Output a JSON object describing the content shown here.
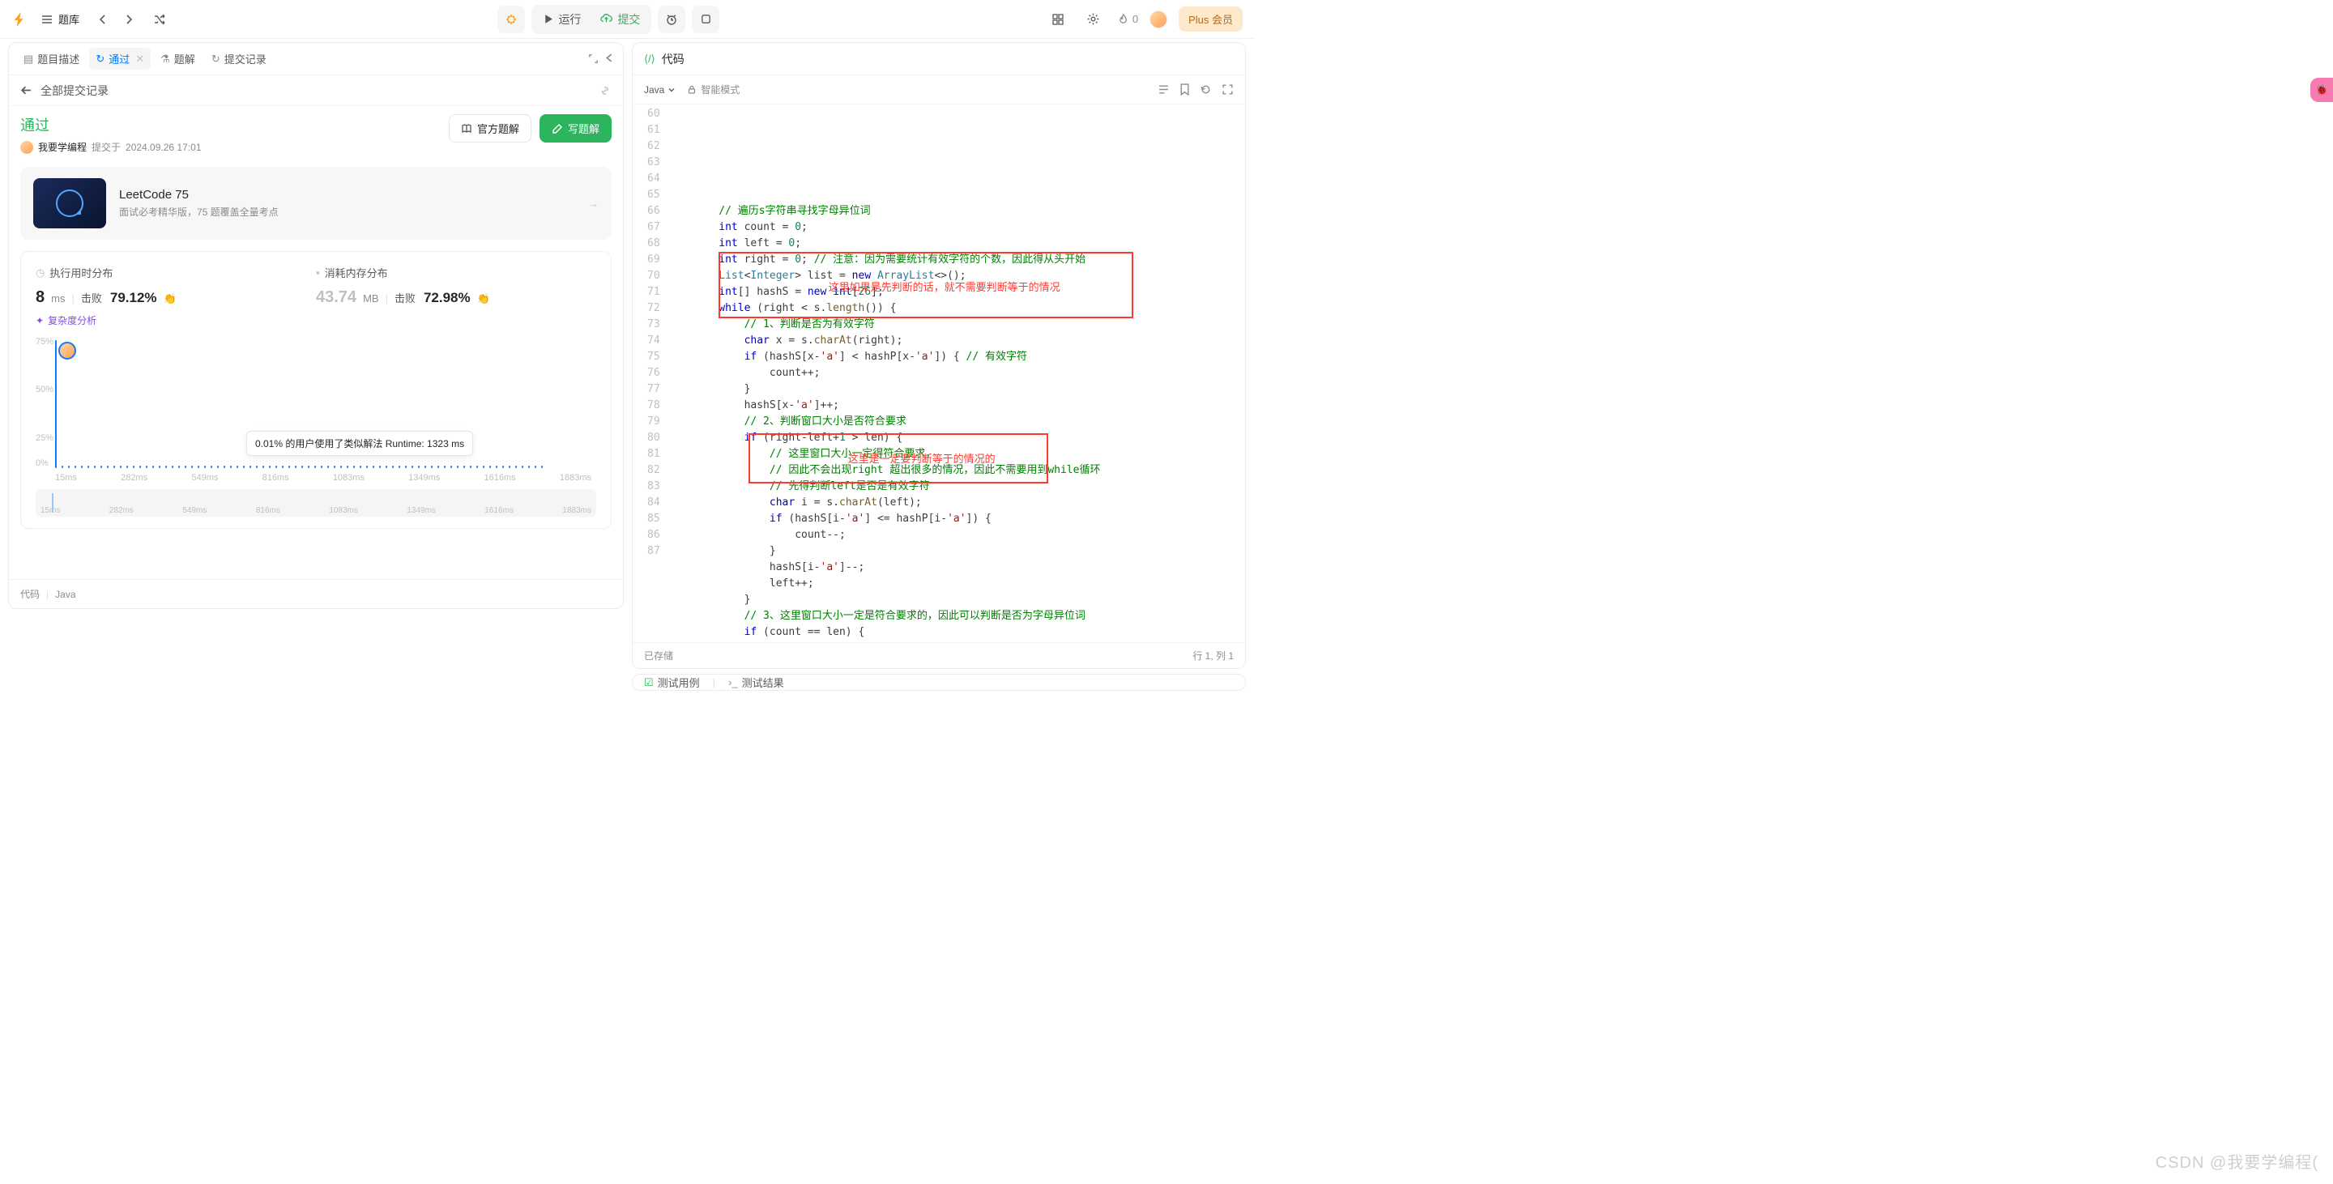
{
  "topbar": {
    "bank": "题库",
    "run": "运行",
    "submit": "提交",
    "streak": "0",
    "plus": "Plus 会员"
  },
  "left": {
    "tabs": {
      "desc": "题目描述",
      "accepted": "通过",
      "editorial": "题解",
      "submissions": "提交记录"
    },
    "breadcrumb": "全部提交记录",
    "status": "通过",
    "user": "我要学编程",
    "submitted_prefix": "提交于",
    "submitted_time": "2024.09.26 17:01",
    "official": "官方题解",
    "write": "写题解",
    "promo": {
      "title": "LeetCode 75",
      "sub": "面试必考精华版，75 题覆盖全量考点"
    },
    "runtime": {
      "label": "执行用时分布",
      "value": "8",
      "unit": "ms",
      "beats_label": "击败",
      "beats": "79.12%"
    },
    "memory": {
      "label": "消耗内存分布",
      "value": "43.74",
      "unit": "MB",
      "beats_label": "击败",
      "beats": "72.98%"
    },
    "complexity": "复杂度分析",
    "tooltip": "0.01% 的用户使用了类似解法 Runtime: 1323 ms",
    "yticks": [
      "75%",
      "50%",
      "25%",
      "0%"
    ],
    "xticks": [
      "15ms",
      "282ms",
      "549ms",
      "816ms",
      "1083ms",
      "1349ms",
      "1616ms",
      "1883ms"
    ],
    "footer": {
      "code": "代码",
      "lang": "Java"
    }
  },
  "right": {
    "title": "代码",
    "lang": "Java",
    "smart": "智能模式",
    "saved": "已存储",
    "pos": "行 1, 列 1",
    "bt_tc": "测试用例",
    "bt_tr": "测试结果",
    "annot1": "这里如果是先判断的话，就不需要判断等于的情况",
    "annot2": "这里是一定要判断等于的情况的",
    "lines": [
      {
        "n": 60,
        "i": 2,
        "t": [
          [
            "cm",
            "// 遍历s字符串寻找字母异位词"
          ]
        ]
      },
      {
        "n": 61,
        "i": 2,
        "t": [
          [
            "kw",
            "int"
          ],
          [
            "",
            " count = "
          ],
          [
            "num",
            "0"
          ],
          [
            "",
            ";"
          ]
        ]
      },
      {
        "n": 62,
        "i": 2,
        "t": [
          [
            "kw",
            "int"
          ],
          [
            "",
            " left = "
          ],
          [
            "num",
            "0"
          ],
          [
            "",
            ";"
          ]
        ]
      },
      {
        "n": 63,
        "i": 2,
        "t": [
          [
            "kw",
            "int"
          ],
          [
            "",
            " right = "
          ],
          [
            "num",
            "0"
          ],
          [
            "",
            "; "
          ],
          [
            "cm",
            "// 注意：因为需要统计有效字符的个数，因此得从头开始"
          ]
        ]
      },
      {
        "n": 64,
        "i": 2,
        "t": [
          [
            "ty",
            "List"
          ],
          [
            "",
            "<"
          ],
          [
            "ty",
            "Integer"
          ],
          [
            "",
            "> list = "
          ],
          [
            "kw",
            "new"
          ],
          [
            "",
            " "
          ],
          [
            "ty",
            "ArrayList"
          ],
          [
            "",
            "<>();"
          ]
        ]
      },
      {
        "n": 65,
        "i": 2,
        "t": [
          [
            "kw",
            "int"
          ],
          [
            "",
            "[] hashS = "
          ],
          [
            "kw",
            "new"
          ],
          [
            "",
            " "
          ],
          [
            "kw",
            "int"
          ],
          [
            "",
            "["
          ],
          [
            "num",
            "26"
          ],
          [
            "",
            "];"
          ]
        ]
      },
      {
        "n": 66,
        "i": 2,
        "t": [
          [
            "kw",
            "while"
          ],
          [
            "",
            " (right < s."
          ],
          [
            "fn",
            "length"
          ],
          [
            "",
            "()) {"
          ]
        ]
      },
      {
        "n": 67,
        "i": 3,
        "t": [
          [
            "cm",
            "// 1、判断是否为有效字符"
          ]
        ]
      },
      {
        "n": 68,
        "i": 3,
        "t": [
          [
            "kw",
            "char"
          ],
          [
            "",
            " x = s."
          ],
          [
            "fn",
            "charAt"
          ],
          [
            "",
            "(right);"
          ]
        ]
      },
      {
        "n": 69,
        "i": 0,
        "t": [
          [
            "",
            ""
          ]
        ]
      },
      {
        "n": 70,
        "i": 3,
        "t": [
          [
            "kw",
            "if"
          ],
          [
            "",
            " (hashS[x-"
          ],
          [
            "str",
            "'a'"
          ],
          [
            "",
            "] < hashP[x-"
          ],
          [
            "str",
            "'a'"
          ],
          [
            "",
            "]) { "
          ],
          [
            "cm",
            "// 有效字符"
          ]
        ]
      },
      {
        "n": 71,
        "i": 4,
        "t": [
          [
            "",
            "count++;"
          ]
        ]
      },
      {
        "n": 72,
        "i": 3,
        "t": [
          [
            "",
            "}"
          ]
        ]
      },
      {
        "n": 73,
        "i": 3,
        "t": [
          [
            "",
            "hashS[x-"
          ],
          [
            "str",
            "'a'"
          ],
          [
            "",
            "]++;"
          ]
        ]
      },
      {
        "n": 74,
        "i": 3,
        "t": [
          [
            "cm",
            "// 2、判断窗口大小是否符合要求"
          ]
        ]
      },
      {
        "n": 75,
        "i": 3,
        "t": [
          [
            "kw",
            "if"
          ],
          [
            "",
            " (right-left+"
          ],
          [
            "num",
            "1"
          ],
          [
            "",
            " > len) {"
          ]
        ]
      },
      {
        "n": 76,
        "i": 4,
        "t": [
          [
            "cm",
            "// 这里窗口大小一定得符合要求，"
          ]
        ]
      },
      {
        "n": 77,
        "i": 4,
        "t": [
          [
            "cm",
            "// 因此不会出现right 超出很多的情况，因此不需要用到while循环"
          ]
        ]
      },
      {
        "n": 78,
        "i": 4,
        "t": [
          [
            "cm",
            "// 先得判断left是否是有效字符"
          ]
        ]
      },
      {
        "n": 79,
        "i": 4,
        "t": [
          [
            "kw",
            "char"
          ],
          [
            "",
            " i = s."
          ],
          [
            "fn",
            "charAt"
          ],
          [
            "",
            "(left);"
          ]
        ]
      },
      {
        "n": 80,
        "i": 4,
        "t": [
          [
            "kw",
            "if"
          ],
          [
            "",
            " (hashS[i-"
          ],
          [
            "str",
            "'a'"
          ],
          [
            "",
            "] <= hashP[i-"
          ],
          [
            "str",
            "'a'"
          ],
          [
            "",
            "]) {"
          ]
        ]
      },
      {
        "n": 81,
        "i": 5,
        "t": [
          [
            "",
            "count--;"
          ]
        ]
      },
      {
        "n": 82,
        "i": 4,
        "t": [
          [
            "",
            "}"
          ]
        ]
      },
      {
        "n": 83,
        "i": 4,
        "t": [
          [
            "",
            "hashS[i-"
          ],
          [
            "str",
            "'a'"
          ],
          [
            "",
            "]--;"
          ]
        ]
      },
      {
        "n": 84,
        "i": 4,
        "t": [
          [
            "",
            "left++;"
          ]
        ]
      },
      {
        "n": 85,
        "i": 3,
        "t": [
          [
            "",
            "}"
          ]
        ]
      },
      {
        "n": 86,
        "i": 3,
        "t": [
          [
            "cm",
            "// 3、这里窗口大小一定是符合要求的，因此可以判断是否为字母异位词"
          ]
        ]
      },
      {
        "n": 87,
        "i": 3,
        "t": [
          [
            "kw",
            "if"
          ],
          [
            "",
            " (count == len) {"
          ]
        ]
      }
    ]
  },
  "chart_data": {
    "type": "bar",
    "title": "执行用时分布",
    "xlabel": "ms",
    "ylabel": "%",
    "ylim": [
      0,
      75
    ],
    "xticks": [
      "15ms",
      "282ms",
      "549ms",
      "816ms",
      "1083ms",
      "1349ms",
      "1616ms",
      "1883ms"
    ],
    "categories": [
      15,
      40,
      65,
      90,
      115,
      140,
      165,
      190,
      215,
      240,
      265,
      290,
      315,
      340,
      365,
      390,
      415,
      440,
      465,
      490,
      515,
      540,
      565,
      590,
      615,
      640,
      665,
      690,
      715,
      740,
      765,
      790,
      815,
      840,
      865,
      890,
      915,
      940,
      965,
      990,
      1015,
      1040,
      1065,
      1090,
      1115,
      1140,
      1165,
      1190,
      1215,
      1240,
      1265,
      1290,
      1315,
      1340,
      1365,
      1390,
      1415,
      1440,
      1465,
      1490,
      1515,
      1540,
      1565,
      1590,
      1615,
      1640,
      1665,
      1690,
      1715,
      1740,
      1765,
      1790,
      1815,
      1840,
      1865,
      1890
    ],
    "values": [
      75,
      1,
      1,
      1,
      1,
      1,
      1,
      1,
      1,
      1,
      1,
      1,
      1,
      1,
      1,
      1,
      1,
      1,
      1,
      1,
      1,
      1,
      1,
      1,
      1,
      1,
      1,
      1,
      1,
      1,
      1,
      1,
      1,
      1,
      1,
      1,
      1,
      1,
      1,
      1,
      1,
      1,
      1,
      1,
      1,
      1,
      1,
      1,
      1,
      1,
      1,
      1,
      1,
      1,
      1,
      1,
      1,
      1,
      1,
      1,
      1,
      1,
      1,
      1,
      1,
      1,
      1,
      1,
      1,
      1,
      1,
      1,
      1,
      1,
      1,
      1
    ],
    "marker": {
      "runtime_ms": 8,
      "percentile": 79.12
    },
    "tooltip": {
      "percent_users": 0.01,
      "runtime_ms": 1323
    }
  },
  "watermark": "CSDN @我要学编程("
}
